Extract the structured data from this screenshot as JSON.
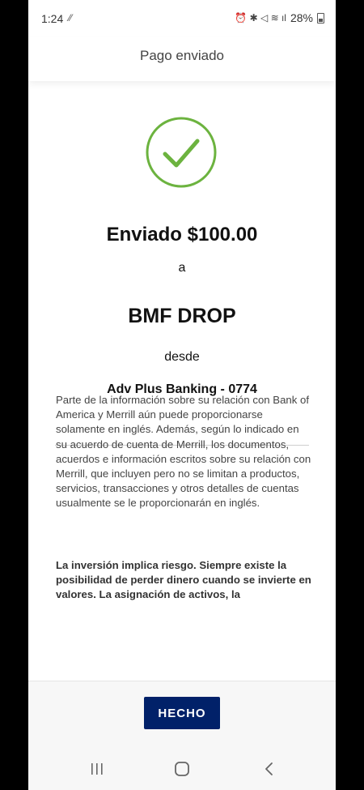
{
  "status_bar": {
    "time": "1:24",
    "left_icon": "mute-icon",
    "right_icons": "⏰ ✱ ◁ ≋ ıl",
    "battery": "28%"
  },
  "header": {
    "title": "Pago enviado"
  },
  "confirmation": {
    "sent_line": "Enviado $100.00",
    "to_word": "a",
    "recipient": "BMF DROP",
    "from_word": "desde",
    "account": "Adv Plus Banking - 0774"
  },
  "disclosure": {
    "paragraph": "Parte de la información sobre su relación con Bank of America y Merrill aún puede proporcionarse solamente en inglés. Además, según lo indicado en su acuerdo de cuenta de Merrill, los documentos, acuerdos e información escritos sobre su relación con Merrill, que incluyen pero no se limitan a productos, servicios, transacciones y otros detalles de cuentas usualmente se le proporcionarán en inglés.",
    "bold_paragraph": "La inversión implica riesgo. Siempre existe la posibilidad de perder dinero cuando se invierte en valores. La asignación de activos, la"
  },
  "footer": {
    "done_label": "HECHO"
  },
  "colors": {
    "check_green": "#6cb33f",
    "button_navy": "#012169"
  },
  "nav_icons": [
    "recent-apps-icon",
    "home-icon",
    "back-icon"
  ]
}
